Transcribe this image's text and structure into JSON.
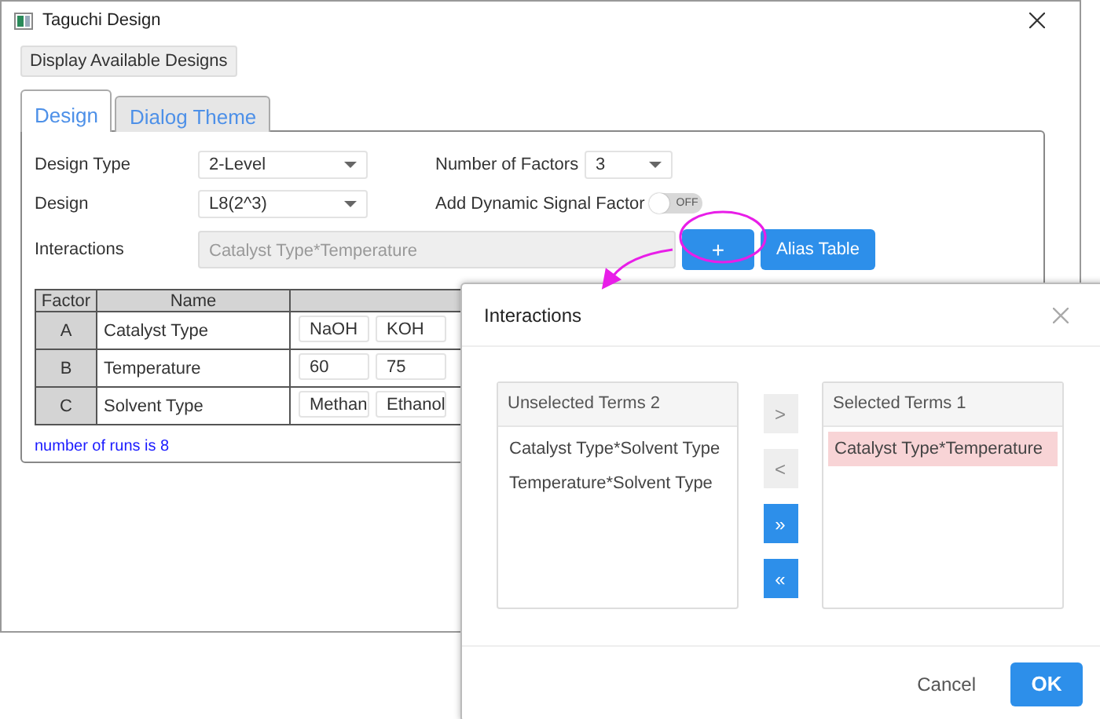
{
  "window": {
    "title": "Taguchi Design"
  },
  "toolbar_button": "Display Available Designs",
  "tabs": [
    {
      "label": "Design",
      "selected": true
    },
    {
      "label": "Dialog Theme",
      "selected": false
    }
  ],
  "form": {
    "design_type": {
      "label": "Design Type",
      "value": "2-Level"
    },
    "number_of_factors": {
      "label": "Number of Factors",
      "value": "3"
    },
    "design": {
      "label": "Design",
      "value": "L8(2^3)"
    },
    "dynamic_signal": {
      "label": "Add Dynamic Signal Factor",
      "on": false,
      "toggle_text": "OFF"
    },
    "interactions": {
      "label": "Interactions",
      "value": "Catalyst Type*Temperature",
      "disabled": true
    },
    "add_button": "+",
    "alias_button": "Alias Table"
  },
  "table": {
    "columns": [
      "Factor",
      "Name"
    ],
    "rows": [
      {
        "factor": "A",
        "name": "Catalyst Type",
        "levels": [
          "NaOH",
          "KOH"
        ]
      },
      {
        "factor": "B",
        "name": "Temperature",
        "levels": [
          "60",
          "75"
        ]
      },
      {
        "factor": "C",
        "name": "Solvent Type",
        "levels": [
          "Methan",
          "Ethanol"
        ]
      }
    ]
  },
  "status_text": "number of runs is 8",
  "dialog": {
    "title": "Interactions",
    "unselected": {
      "header": "Unselected Terms 2",
      "items": [
        {
          "label": "Catalyst Type*Solvent Type",
          "selected": false
        },
        {
          "label": "Temperature*Solvent Type",
          "selected": false
        }
      ]
    },
    "selected": {
      "header": "Selected Terms 1",
      "items": [
        {
          "label": "Catalyst Type*Temperature",
          "selected": true
        }
      ]
    },
    "move_buttons": [
      {
        "label": ">",
        "kind": "plain"
      },
      {
        "label": "<",
        "kind": "plain"
      },
      {
        "label": "»",
        "kind": "primary"
      },
      {
        "label": "«",
        "kind": "primary"
      }
    ],
    "cancel": "Cancel",
    "ok": "OK"
  }
}
